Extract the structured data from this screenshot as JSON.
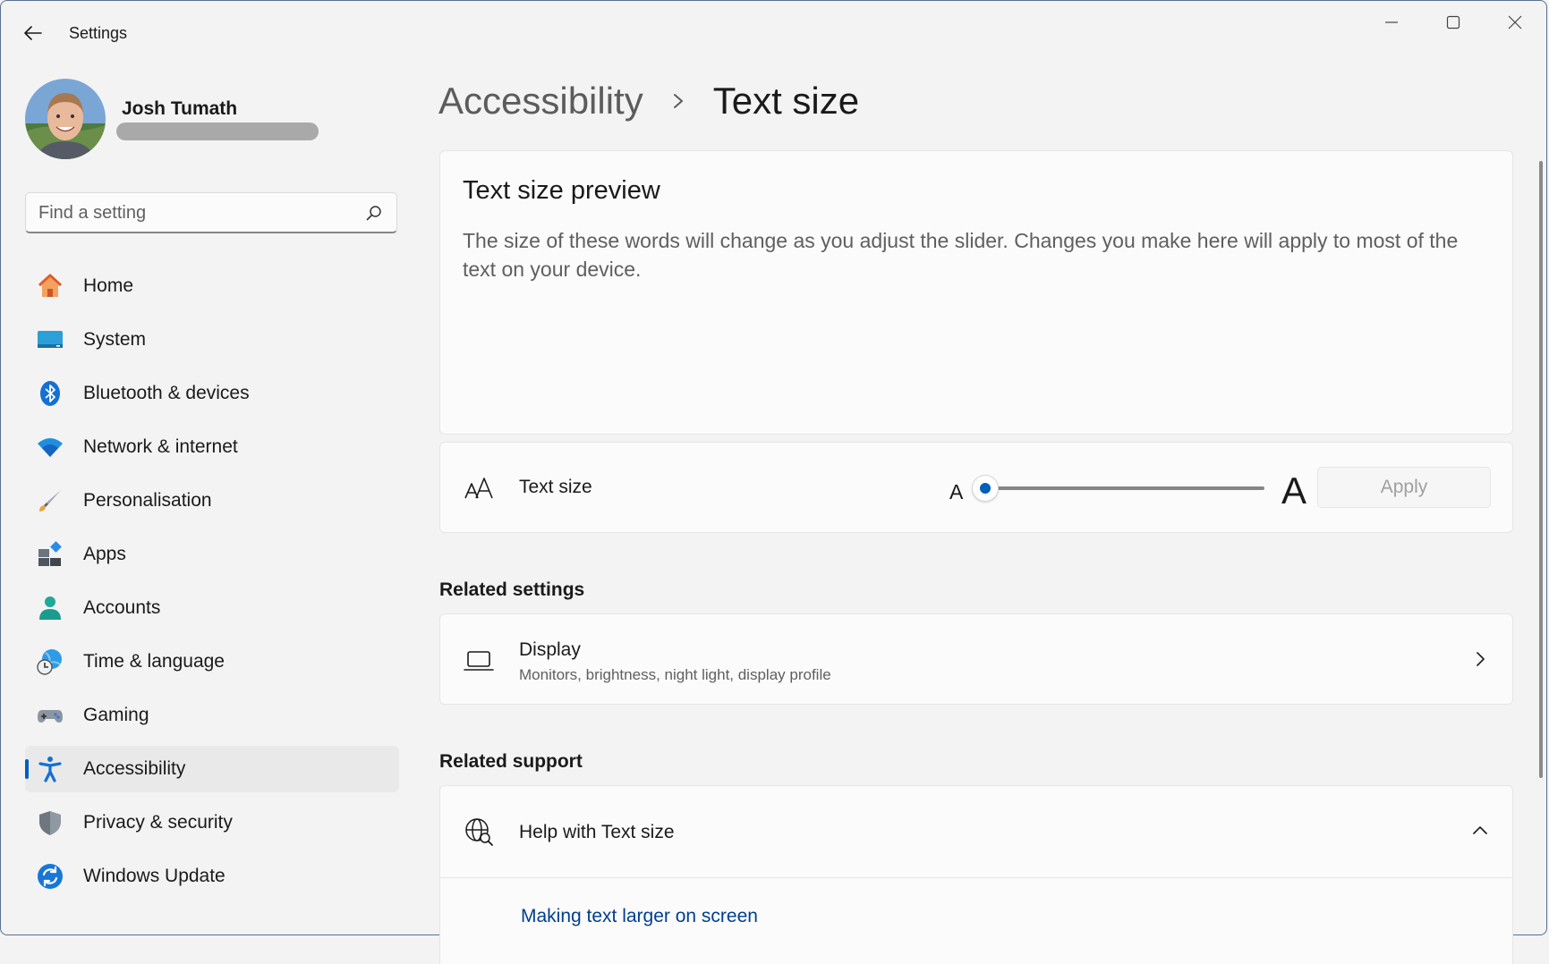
{
  "window": {
    "title": "Settings",
    "controls": [
      "minimize-icon",
      "maximize-icon",
      "close-icon"
    ]
  },
  "user": {
    "name": "Josh Tumath"
  },
  "search": {
    "placeholder": "Find a setting",
    "value": ""
  },
  "sidebar": {
    "items": [
      {
        "label": "Home",
        "icon": "home-icon",
        "active": false
      },
      {
        "label": "System",
        "icon": "system-icon",
        "active": false
      },
      {
        "label": "Bluetooth & devices",
        "icon": "bluetooth-icon",
        "active": false
      },
      {
        "label": "Network & internet",
        "icon": "wifi-icon",
        "active": false
      },
      {
        "label": "Personalisation",
        "icon": "brush-icon",
        "active": false
      },
      {
        "label": "Apps",
        "icon": "apps-icon",
        "active": false
      },
      {
        "label": "Accounts",
        "icon": "accounts-icon",
        "active": false
      },
      {
        "label": "Time & language",
        "icon": "time-language-icon",
        "active": false
      },
      {
        "label": "Gaming",
        "icon": "gamepad-icon",
        "active": false
      },
      {
        "label": "Accessibility",
        "icon": "accessibility-icon",
        "active": true
      },
      {
        "label": "Privacy & security",
        "icon": "shield-icon",
        "active": false
      },
      {
        "label": "Windows Update",
        "icon": "update-icon",
        "active": false
      }
    ]
  },
  "breadcrumb": {
    "parent": "Accessibility",
    "current": "Text size"
  },
  "preview": {
    "title": "Text size preview",
    "text": "The size of these words will change as you adjust the slider. Changes you make here will apply to most of the text on your device."
  },
  "text_size": {
    "label": "Text size",
    "small_glyph": "A",
    "large_glyph": "A",
    "slider_fraction": 0,
    "apply_label": "Apply"
  },
  "related_settings": {
    "heading": "Related settings",
    "display": {
      "title": "Display",
      "subtitle": "Monitors, brightness, night light, display profile"
    }
  },
  "related_support": {
    "heading": "Related support",
    "help_title": "Help with Text size",
    "link": "Making text larger on screen"
  },
  "colors": {
    "accent": "#005fb8",
    "background": "#f3f3f3",
    "card": "#fbfbfb",
    "link": "#003e92"
  }
}
